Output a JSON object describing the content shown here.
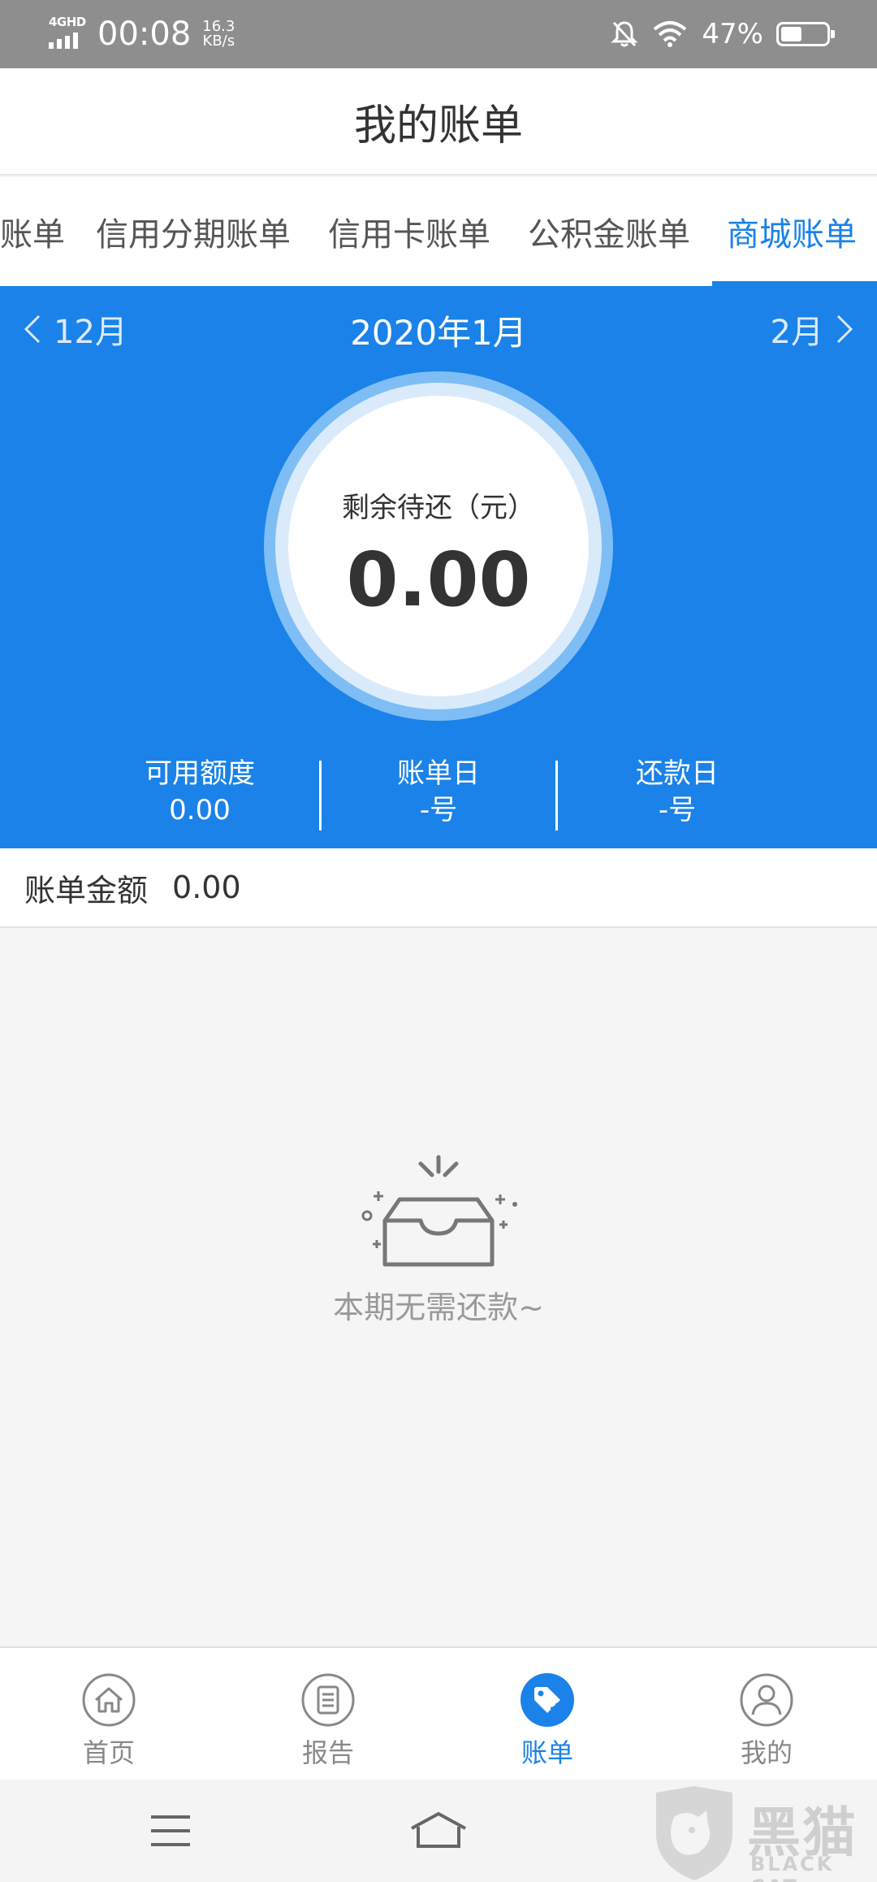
{
  "status_bar": {
    "network": "4GHD",
    "time": "00:08",
    "speed_value": "16.3",
    "speed_unit": "KB/s",
    "battery_percent": "47%",
    "battery_level": 0.47,
    "icons": [
      "mute-bell-icon",
      "wifi-icon",
      "battery-icon"
    ]
  },
  "header": {
    "title": "我的账单"
  },
  "tabs": [
    {
      "label": "账单",
      "active": false
    },
    {
      "label": "信用分期账单",
      "active": false
    },
    {
      "label": "信用卡账单",
      "active": false
    },
    {
      "label": "公积金账单",
      "active": false
    },
    {
      "label": "商城账单",
      "active": true
    }
  ],
  "month_nav": {
    "prev": "12月",
    "current": "2020年1月",
    "next": "2月"
  },
  "summary": {
    "label": "剩余待还（元）",
    "value": "0.00"
  },
  "stats": [
    {
      "label": "可用额度",
      "value": "0.00"
    },
    {
      "label": "账单日",
      "value": "-号"
    },
    {
      "label": "还款日",
      "value": "-号"
    }
  ],
  "bill_amount": {
    "label": "账单金额",
    "value": "0.00"
  },
  "empty_state": {
    "text": "本期无需还款~",
    "icon": "empty-box-icon"
  },
  "bottom_nav": [
    {
      "label": "首页",
      "icon": "home-icon",
      "active": false
    },
    {
      "label": "报告",
      "icon": "report-icon",
      "active": false
    },
    {
      "label": "账单",
      "icon": "tag-icon",
      "active": true
    },
    {
      "label": "我的",
      "icon": "user-icon",
      "active": false
    }
  ],
  "watermark": {
    "text_cn": "黑猫",
    "text_en": "BLACK CAT"
  },
  "colors": {
    "accent": "#1a82e8",
    "status_bar": "#8e8e8e",
    "text_primary": "#333333",
    "text_muted": "#999999"
  }
}
